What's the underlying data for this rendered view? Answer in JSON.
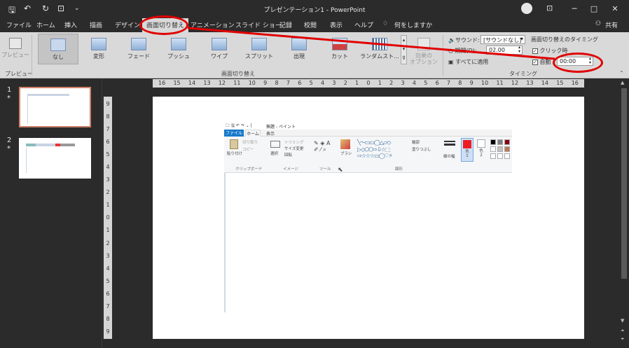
{
  "window": {
    "title": "プレゼンテーション1  -  PowerPoint",
    "share_label": "共有",
    "controls": [
      "─",
      "□",
      "✕"
    ]
  },
  "tabs": [
    "ファイル",
    "ホーム",
    "挿入",
    "描画",
    "デザイン",
    "画面切り替え",
    "アニメーション",
    "スライド ショー",
    "記録",
    "校閲",
    "表示",
    "ヘルプ",
    "何をしますか"
  ],
  "active_tab": "画面切り替え",
  "ribbon": {
    "preview_label": "プレビュー",
    "preview_group": "プレビュー",
    "transitions": [
      "なし",
      "変形",
      "フェード",
      "プッシュ",
      "ワイプ",
      "スプリット",
      "出現",
      "カット",
      "ランダムスト..."
    ],
    "effect_options": "効果の\nオプション",
    "transitions_group": "画面切り替え",
    "sound_label": "サウンド:",
    "sound_value": "[サウンドなし]",
    "duration_label": "期間(D):",
    "duration_value": "02.00",
    "apply_all": "すべてに適用",
    "timing_title": "画面切り替えのタイミング",
    "on_click": "クリック時",
    "after_label": "自動",
    "after_value": "00:00",
    "timing_group": "タイミング"
  },
  "slides": [
    {
      "number": "1",
      "star": "*"
    },
    {
      "number": "2",
      "star": "*"
    }
  ],
  "ruler_h": [
    "16",
    "15",
    "14",
    "13",
    "12",
    "11",
    "10",
    "9",
    "8",
    "7",
    "6",
    "5",
    "4",
    "3",
    "2",
    "1",
    "0",
    "1",
    "2",
    "3",
    "4",
    "5",
    "6",
    "7",
    "8",
    "9",
    "10",
    "11",
    "12",
    "13",
    "14",
    "15",
    "16"
  ],
  "ruler_v": [
    "9",
    "8",
    "7",
    "6",
    "5",
    "4",
    "3",
    "2",
    "1",
    "0",
    "1",
    "2",
    "3",
    "4",
    "5",
    "6",
    "7",
    "8",
    "9"
  ],
  "paint": {
    "title": "無題 - ペイント",
    "tabs": [
      "ファイル",
      "ホーム",
      "表示"
    ],
    "paste": "貼り付け",
    "cut": "切り取り",
    "copy": "コピー",
    "select": "選択",
    "crop": "トリミング",
    "resize": "サイズ変更",
    "rotate": "回転",
    "brush": "ブラシ",
    "outline": "輪郭",
    "fill": "塗りつぶし",
    "size": "線の幅",
    "color1": "色\n1",
    "color2": "色\n2",
    "groups": [
      "クリップボード",
      "イメージ",
      "ツール",
      "図形"
    ]
  },
  "colors": {
    "annotation": "#e00000",
    "ribbon_bg": "#d9d9d9",
    "dark_bg": "#2b2b2b"
  }
}
